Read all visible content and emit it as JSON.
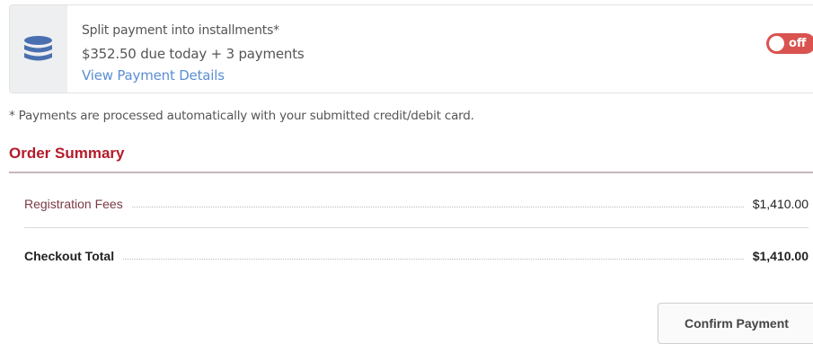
{
  "installments": {
    "title": "Split payment into installments*",
    "amount_text": "$352.50 due today + 3 payments",
    "details_link": "View Payment Details",
    "toggle_label": "off",
    "toggle_state": "off",
    "icon": "database-stack-icon",
    "icon_color": "#4a6fb0",
    "toggle_color": "#d9534f"
  },
  "note": "* Payments are processed automatically with your submitted credit/debit card.",
  "order_summary": {
    "title": "Order Summary",
    "title_color": "#b51b2a",
    "rows": [
      {
        "label": "Registration Fees",
        "amount": "$1,410.00"
      }
    ],
    "total": {
      "label": "Checkout Total",
      "amount": "$1,410.00"
    }
  },
  "actions": {
    "confirm_label": "Confirm Payment"
  }
}
